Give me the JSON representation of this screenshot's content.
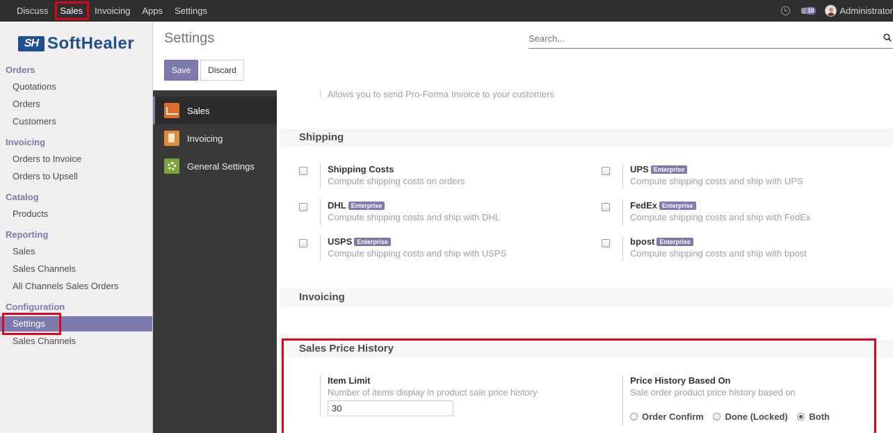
{
  "topbar": {
    "menus": [
      "Discuss",
      "Sales",
      "Invoicing",
      "Apps",
      "Settings"
    ],
    "active_menu": "Sales",
    "chat_count": "10",
    "user_name": "Administrator"
  },
  "brand": {
    "logo_mark": "SH",
    "logo_text": "SoftHealer"
  },
  "sidebar": {
    "sections": [
      {
        "title": "Orders",
        "items": [
          "Quotations",
          "Orders",
          "Customers"
        ]
      },
      {
        "title": "Invoicing",
        "items": [
          "Orders to Invoice",
          "Orders to Upsell"
        ]
      },
      {
        "title": "Catalog",
        "items": [
          "Products"
        ]
      },
      {
        "title": "Reporting",
        "items": [
          "Sales",
          "Sales Channels",
          "All Channels Sales Orders"
        ]
      },
      {
        "title": "Configuration",
        "items": [
          "Settings",
          "Sales Channels"
        ]
      }
    ],
    "active_item": "Settings"
  },
  "control_panel": {
    "title": "Settings",
    "search_placeholder": "Search...",
    "save_label": "Save",
    "discard_label": "Discard"
  },
  "apps": [
    {
      "label": "Sales",
      "icon": "chart-line-icon"
    },
    {
      "label": "Invoicing",
      "icon": "invoice-document-icon"
    },
    {
      "label": "General Settings",
      "icon": "gear-icon"
    }
  ],
  "content": {
    "proforma_desc": "Allows you to send Pro-Forma Invoice to your customers",
    "shipping": {
      "title": "Shipping",
      "enterprise_badge": "Enterprise",
      "items": [
        {
          "label": "Shipping Costs",
          "desc": "Compute shipping costs on orders",
          "enterprise": false
        },
        {
          "label": "UPS",
          "desc": "Compute shipping costs and ship with UPS",
          "enterprise": true
        },
        {
          "label": "DHL",
          "desc": "Compute shipping costs and ship with DHL",
          "enterprise": true
        },
        {
          "label": "FedEx",
          "desc": "Compute shipping costs and ship with FedEx",
          "enterprise": true
        },
        {
          "label": "USPS",
          "desc": "Compute shipping costs and ship with USPS",
          "enterprise": true
        },
        {
          "label": "bpost",
          "desc": "Compute shipping costs and ship with bpost",
          "enterprise": true
        }
      ]
    },
    "invoicing": {
      "title": "Invoicing"
    },
    "price_history": {
      "title": "Sales Price History",
      "item_limit_label": "Item Limit",
      "item_limit_desc": "Number of items display in product sale price history",
      "item_limit_value": "30",
      "based_on_label": "Price History Based On",
      "based_on_desc": "Sale order product price history based on",
      "options": [
        "Order Confirm",
        "Done (Locked)",
        "Both"
      ],
      "selected": "Both"
    }
  },
  "colors": {
    "primary": "#7c7bad",
    "highlight_box": "#e4001b",
    "topbar": "#2f2f2f",
    "app_sidebar": "#393939"
  }
}
